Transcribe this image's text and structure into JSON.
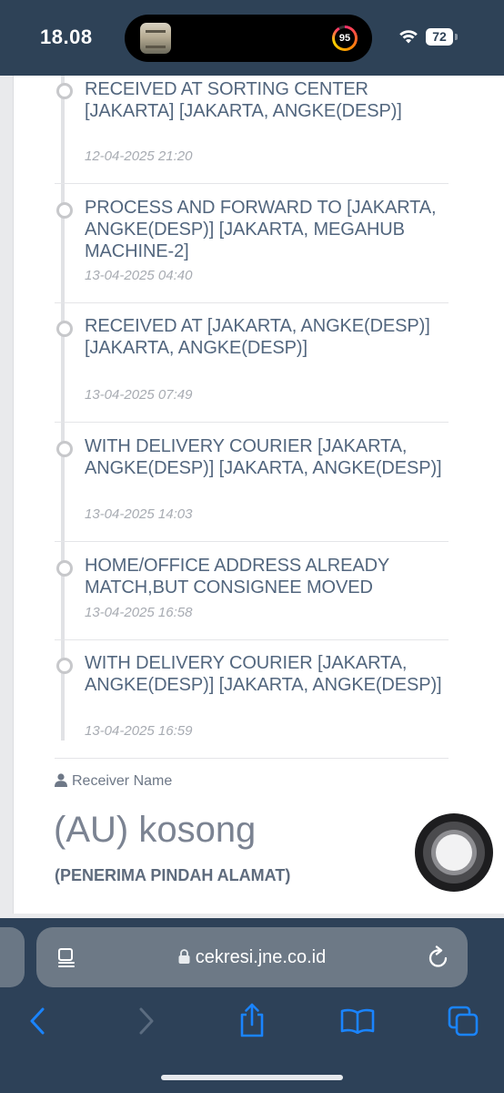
{
  "status_bar": {
    "time": "18.08",
    "activity_ring": "95",
    "battery": "72"
  },
  "tracking": {
    "events": [
      {
        "text": "RECEIVED AT SORTING CENTER [JAKARTA] [JAKARTA, ANGKE(DESP)]",
        "datetime": "12-04-2025 21:20"
      },
      {
        "text": "PROCESS AND FORWARD TO [JAKARTA, ANGKE(DESP)] [JAKARTA, MEGAHUB MACHINE-2]",
        "datetime": "13-04-2025 04:40"
      },
      {
        "text": "RECEIVED AT [JAKARTA, ANGKE(DESP)] [JAKARTA, ANGKE(DESP)]",
        "datetime": "13-04-2025 07:49"
      },
      {
        "text": "WITH DELIVERY COURIER [JAKARTA, ANGKE(DESP)] [JAKARTA, ANGKE(DESP)]",
        "datetime": "13-04-2025 14:03"
      },
      {
        "text": "HOME/OFFICE ADDRESS ALREADY MATCH,BUT CONSIGNEE MOVED",
        "datetime": "13-04-2025 16:58"
      },
      {
        "text": "WITH DELIVERY COURIER [JAKARTA, ANGKE(DESP)] [JAKARTA, ANGKE(DESP)]",
        "datetime": "13-04-2025 16:59"
      }
    ]
  },
  "receiver": {
    "label": "Receiver Name",
    "name": "(AU) kosong",
    "note": "(PENERIMA PINDAH ALAMAT)"
  },
  "browser": {
    "url": "cekresi.jne.co.id",
    "icons": [
      "reader-icon",
      "lock-icon",
      "reload-icon",
      "back-icon",
      "forward-icon",
      "share-icon",
      "bookmarks-icon",
      "tabs-icon"
    ],
    "accent": "#1a84ff"
  }
}
